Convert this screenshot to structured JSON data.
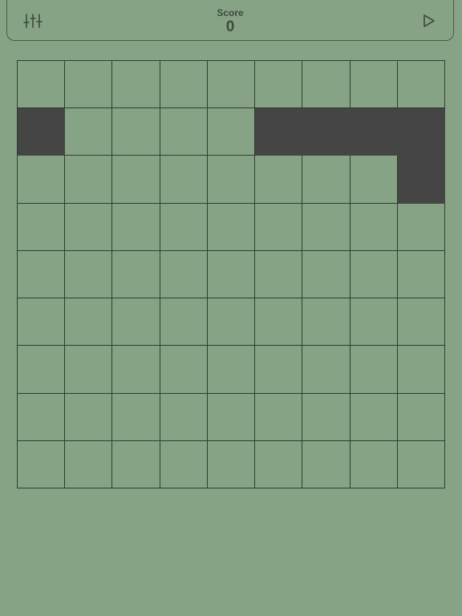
{
  "header": {
    "score_label": "Score",
    "score_value": "0",
    "settings_icon": "sliders-icon",
    "play_icon": "play-icon"
  },
  "colors": {
    "background": "#87a386",
    "grid_line": "#2f3d2f",
    "filled_cell": "#454545",
    "text": "#3d4a3d"
  },
  "board": {
    "rows": 9,
    "cols": 9,
    "filled_cells": [
      [
        1,
        0
      ],
      [
        1,
        5
      ],
      [
        1,
        6
      ],
      [
        1,
        7
      ],
      [
        1,
        8
      ],
      [
        2,
        8
      ]
    ]
  }
}
